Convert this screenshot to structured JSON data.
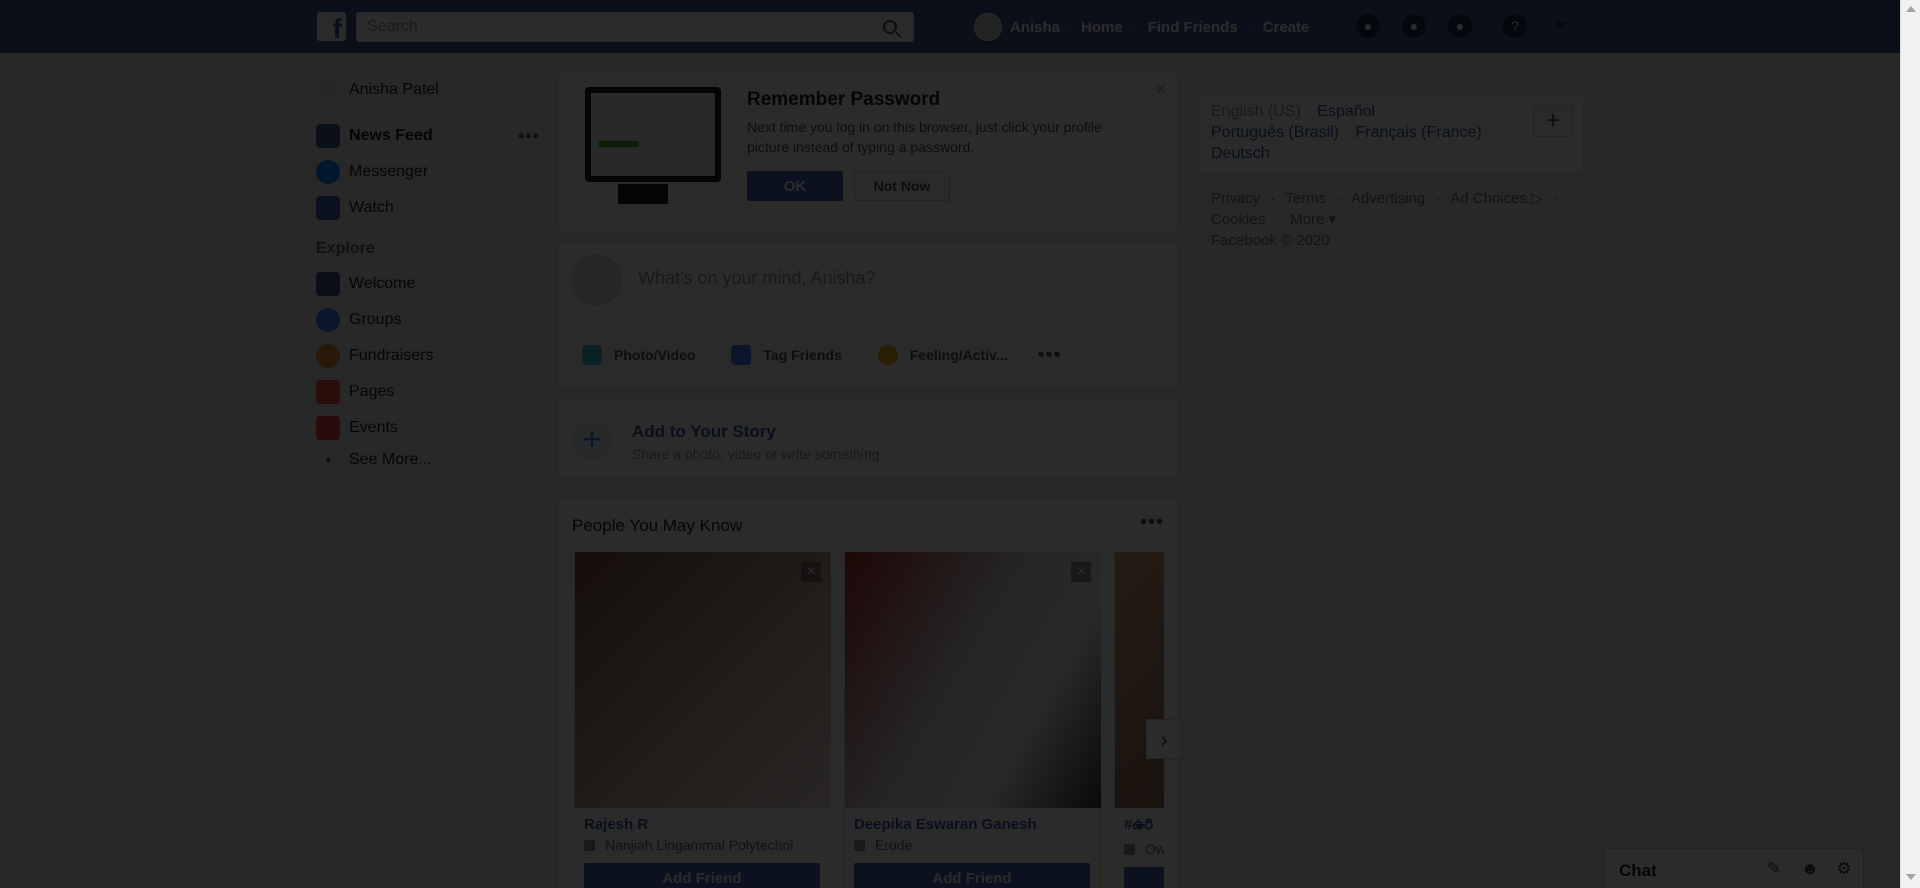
{
  "topbar": {
    "logo": "f",
    "search_placeholder": "Search",
    "user_name": "Anisha",
    "links": [
      "Home",
      "Find Friends",
      "Create"
    ]
  },
  "leftnav": {
    "profile": "Anisha Patel",
    "items": [
      {
        "label": "News Feed",
        "icon": "news-feed-icon",
        "color": "#3b5998"
      },
      {
        "label": "Messenger",
        "icon": "messenger-icon",
        "color": "#0084ff"
      },
      {
        "label": "Watch",
        "icon": "watch-icon",
        "color": "#4267b2"
      }
    ],
    "explore_header": "Explore",
    "explore_items": [
      {
        "label": "Welcome",
        "icon": "facebook-icon",
        "color": "#3b5998"
      },
      {
        "label": "Groups",
        "icon": "groups-icon",
        "color": "#4080ff"
      },
      {
        "label": "Fundraisers",
        "icon": "fundraisers-icon",
        "color": "#f7923b"
      },
      {
        "label": "Pages",
        "icon": "pages-icon",
        "color": "#f5533d"
      },
      {
        "label": "Events",
        "icon": "events-icon",
        "color": "#e9443e"
      }
    ],
    "see_more": "See More..."
  },
  "remember": {
    "title": "Remember Password",
    "text": "Next time you log in on this browser, just click your profile picture instead of typing a password.",
    "ok": "OK",
    "not_now": "Not Now"
  },
  "composer": {
    "placeholder": "What's on your mind, Anisha?",
    "actions": [
      {
        "label": "Photo/Video",
        "icon": "photo-video-icon",
        "color": "#44bec7"
      },
      {
        "label": "Tag Friends",
        "icon": "tag-friends-icon",
        "color": "#4080ff"
      },
      {
        "label": "Feeling/Activ...",
        "icon": "feeling-icon",
        "color": "#f7b928"
      }
    ]
  },
  "story": {
    "title": "Add to Your Story",
    "subtitle": "Share a photo, video or write something"
  },
  "pymk": {
    "title": "People You May Know",
    "add_friend": "Add Friend",
    "people": [
      {
        "name": "Rajesh R",
        "meta": "Nanjiah Lingammal Polytechni"
      },
      {
        "name": "Deepika Eswaran Ganesh",
        "meta": "Erode"
      },
      {
        "name": "#ఉరి",
        "meta": "Ow"
      }
    ]
  },
  "languages": {
    "current": "English (US)",
    "others": [
      "Español",
      "Português (Brasil)",
      "Français (France)",
      "Deutsch"
    ]
  },
  "footer": {
    "links": [
      "Privacy",
      "·",
      "Terms",
      "·",
      "Advertising",
      "·",
      "Ad Choices ▷",
      "·",
      "Cookies",
      "·",
      "More ▾"
    ],
    "copyright": "Facebook © 2020"
  },
  "chat": {
    "label": "Chat"
  }
}
